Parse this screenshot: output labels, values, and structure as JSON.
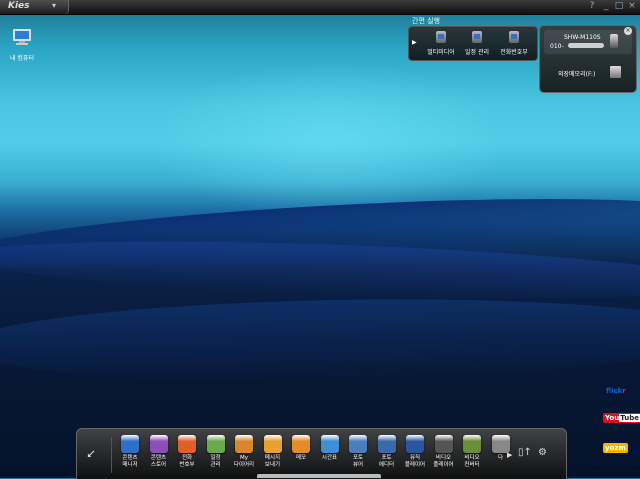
{
  "app": {
    "name": "Kies"
  },
  "window_controls": [
    "?",
    "_",
    "□",
    "×"
  ],
  "desktop": {
    "my_computer": {
      "label": "내 컴퓨터",
      "icon": "computer-icon"
    }
  },
  "quick_launch": {
    "title": "간편 실행",
    "items": [
      {
        "label": "멀티미디어",
        "icon": "phone-media-icon"
      },
      {
        "label": "일정 관리",
        "icon": "calendar-sync-icon"
      },
      {
        "label": "전화번호부",
        "icon": "phonebook-icon"
      }
    ]
  },
  "device": {
    "model": "SHW-M110S",
    "number_prefix": "010-",
    "external_memory_label": "외장메모리(F:)",
    "close": "×"
  },
  "social": {
    "flickr_a": "flick",
    "flickr_b": "r",
    "youtube_a": "You",
    "youtube_b": "Tube",
    "yozm": "yozm"
  },
  "dock": {
    "items": [
      {
        "label": "콘텐츠\n매니저",
        "color": "#2f6fc9"
      },
      {
        "label": "콘텐츠\n스토어",
        "color": "#8a4fb8"
      },
      {
        "label": "전화\n번호부",
        "color": "#e0602a"
      },
      {
        "label": "일정\n관리",
        "color": "#6aa84f"
      },
      {
        "label": "My\n다이어리",
        "color": "#d8882a"
      },
      {
        "label": "메시지\n보내기",
        "color": "#e8a030"
      },
      {
        "label": "메모",
        "color": "#e48b2a"
      },
      {
        "label": "시간표",
        "color": "#3d8fd6"
      },
      {
        "label": "포토\n뷰어",
        "color": "#4a7ec0"
      },
      {
        "label": "포토\n에디터",
        "color": "#3a6aa8"
      },
      {
        "label": "뮤직\n플레이어",
        "color": "#2a55a0"
      },
      {
        "label": "비디오\n플레이어",
        "color": "#555555"
      },
      {
        "label": "비디오\n컨버터",
        "color": "#6a8e3a"
      },
      {
        "label": "다",
        "color": "#888888"
      }
    ]
  }
}
